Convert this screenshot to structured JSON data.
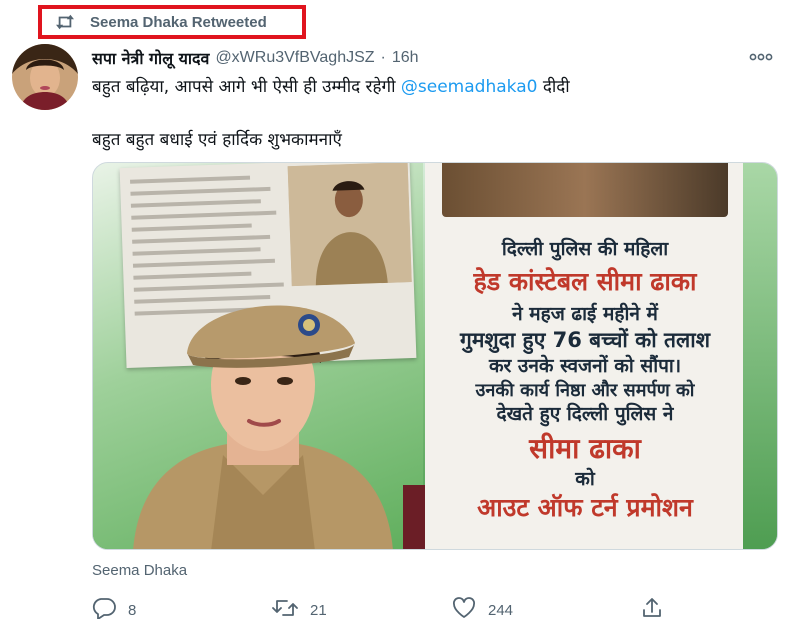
{
  "retweet_banner": {
    "label": "Seema Dhaka Retweeted",
    "icon": "retweet-icon",
    "highlight_color": "#e0141e"
  },
  "tweet": {
    "author_name": "सपा नेत्री गोलू यादव",
    "handle": "@xWRu3VfBVaghJSZ",
    "separator": "·",
    "time": "16h",
    "text_line1_prefix": "बहुत बढ़िया, आपसे आगे भी ऐसी ही उम्मीद रहेगी ",
    "mention": "@seemadhaka0",
    "text_line1_suffix": " दीदी",
    "text_line2": "बहुत बहुत बधाई एवं हार्दिक शुभकामनाएँ",
    "media": {
      "poster_lines": [
        "दिल्ली पुलिस की महिला",
        "हेड कांस्टेबल सीमा ढाका",
        "ने महज ढाई महीने में",
        "गुमशुदा हुए 76 बच्चों को तलाश",
        "कर उनके स्वजनों को सौंपा।",
        "उनकी कार्य निष्ठा और समर्पण को",
        "देखते हुए दिल्ली पुलिस ने",
        "सीमा ढाका",
        "को",
        "आउट ऑफ टर्न प्रमोशन"
      ]
    },
    "media_tag": "Seema Dhaka",
    "actions": {
      "reply_count": "8",
      "retweet_count": "21",
      "like_count": "244"
    }
  },
  "colors": {
    "accent": "#1d9bf0",
    "secondary_text": "#536471",
    "poster_red": "#c0392b"
  }
}
